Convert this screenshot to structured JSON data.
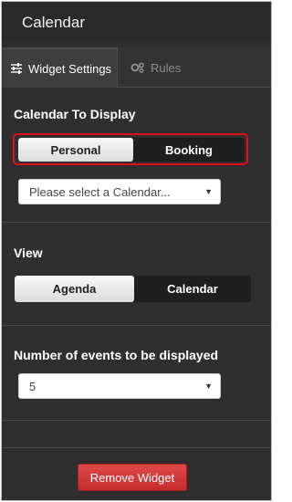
{
  "header": {
    "title": "Calendar"
  },
  "tabs": [
    {
      "label": "Widget Settings",
      "icon": "sliders-icon",
      "active": true
    },
    {
      "label": "Rules",
      "icon": "gears-icon",
      "active": false
    }
  ],
  "calendar_section": {
    "title": "Calendar To Display",
    "toggle": {
      "options": [
        "Personal",
        "Booking"
      ],
      "selected": "Personal"
    },
    "select": {
      "placeholder": "Please select a Calendar...",
      "icon": "chevron-down-icon"
    }
  },
  "view_section": {
    "title": "View",
    "toggle": {
      "options": [
        "Agenda",
        "Calendar"
      ],
      "selected": "Agenda"
    }
  },
  "events_section": {
    "title": "Number of events to be displayed",
    "select": {
      "value": "5",
      "icon": "chevron-down-icon"
    }
  },
  "footer": {
    "remove_label": "Remove Widget"
  },
  "colors": {
    "panel_bg": "#2f2f2f",
    "highlight": "#e0101a",
    "remove_button": "#d13a3a"
  }
}
